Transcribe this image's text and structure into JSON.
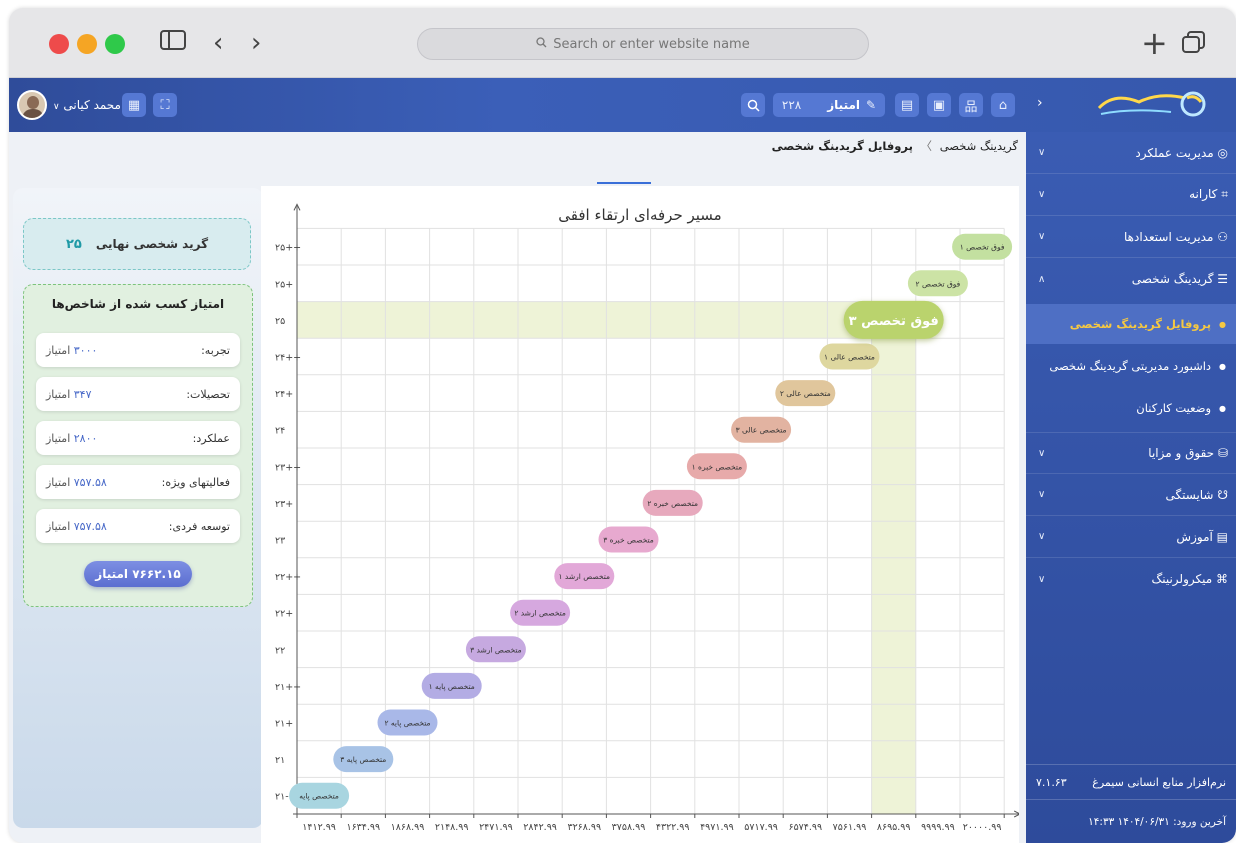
{
  "browser": {
    "search_placeholder": "Search or enter website name",
    "traffic_lights": [
      "#ee4b4b",
      "#f5a524",
      "#2fc94a"
    ]
  },
  "header": {
    "user_name": "محمد کیانی",
    "points_label": "امتیاز",
    "points_value": "۲۲۸"
  },
  "breadcrumb": {
    "parent": "گریدینگ شخصی",
    "separator": "〉",
    "current": "پروفایل گریدینگ شخصی"
  },
  "sidebar": {
    "items": [
      {
        "label": "مدیریت عملکرد",
        "icon": "gauge-icon",
        "expanded": false
      },
      {
        "label": "کارانه",
        "icon": "grid-icon",
        "expanded": false
      },
      {
        "label": "مدیریت استعدادها",
        "icon": "users-icon",
        "expanded": false
      },
      {
        "label": "گریدینگ شخصی",
        "icon": "layers-icon",
        "expanded": true
      }
    ],
    "subitems": [
      {
        "label": "پروفایل گریدینگ شخصی",
        "active": true
      },
      {
        "label": "داشبورد مدیریتی گریدینگ شخصی",
        "active": false
      },
      {
        "label": "وضعیت کارکنان",
        "active": false
      }
    ],
    "items2": [
      {
        "label": "حقوق و مزایا",
        "icon": "coins-icon"
      },
      {
        "label": "شایستگی",
        "icon": "medal-icon"
      },
      {
        "label": "آموزش",
        "icon": "book-icon"
      },
      {
        "label": "میکرولرنینگ",
        "icon": "cap-icon"
      }
    ],
    "app_name": "نرم‌افزار منابع انسانی سیمرغ",
    "version": "۷.۱.۶۳",
    "last_login": "آخرین ورود: ۱۴۰۴/۰۶/۳۱ ۱۴:۳۳"
  },
  "left_panel": {
    "final_grade_label": "گرید شخصی نهایی",
    "final_grade_value": "۲۵",
    "score_title": "امتیاز کسب شده از شاخص‌ها",
    "unit": "امتیاز",
    "rows": [
      {
        "label": "تجربه:",
        "value": "۳۰۰۰"
      },
      {
        "label": "تحصیلات:",
        "value": "۳۴۷"
      },
      {
        "label": "عملکرد:",
        "value": "۲۸۰۰"
      },
      {
        "label": "فعالیتهای ویژه:",
        "value": "۷۵۷.۵۸"
      },
      {
        "label": "توسعه فردی:",
        "value": "۷۵۷.۵۸"
      }
    ],
    "total": "۷۶۶۲.۱۵ امتیاز"
  },
  "chart_data": {
    "type": "scatter",
    "title": "مسیر حرفه‌ای ارتقاء افقی",
    "x_ticks": [
      "۱۴۱۲.۹۹",
      "۱۶۳۴.۹۹",
      "۱۸۶۸.۹۹",
      "۲۱۴۸.۹۹",
      "۲۴۷۱.۹۹",
      "۲۸۴۲.۹۹",
      "۳۲۶۸.۹۹",
      "۳۷۵۸.۹۹",
      "۴۳۲۲.۹۹",
      "۴۹۷۱.۹۹",
      "۵۷۱۷.۹۹",
      "۶۵۷۴.۹۹",
      "۷۵۶۱.۹۹",
      "۸۶۹۵.۹۹",
      "۹۹۹۹.۹۹",
      "۲۰۰۰۰.۹۹"
    ],
    "y_ticks": [
      "۲۱-",
      "۲۱",
      "۲۱+",
      "۲۱++",
      "۲۲",
      "۲۲+",
      "۲۲++",
      "۲۳",
      "۲۳+",
      "۲۳++",
      "۲۴",
      "۲۴+",
      "۲۴++",
      "۲۵",
      "۲۵+",
      "۲۵++"
    ],
    "points": [
      {
        "label": "متخصص پایه",
        "x_index": 0,
        "y_index": 0,
        "color": "#a8d5e0"
      },
      {
        "label": "متخصص پایه ۳",
        "x_index": 1,
        "y_index": 1,
        "color": "#a8c3e6"
      },
      {
        "label": "متخصص پایه ۲",
        "x_index": 2,
        "y_index": 2,
        "color": "#a9b8e8"
      },
      {
        "label": "متخصص پایه ۱",
        "x_index": 3,
        "y_index": 3,
        "color": "#b3ace4"
      },
      {
        "label": "متخصص ارشد ۳",
        "x_index": 4,
        "y_index": 4,
        "color": "#c6a9e0"
      },
      {
        "label": "متخصص ارشد ۲",
        "x_index": 5,
        "y_index": 5,
        "color": "#d6a8df"
      },
      {
        "label": "متخصص ارشد ۱",
        "x_index": 6,
        "y_index": 6,
        "color": "#e2a8d8"
      },
      {
        "label": "متخصص خبره ۳",
        "x_index": 7,
        "y_index": 7,
        "color": "#e7a9cf"
      },
      {
        "label": "متخصص خبره ۲",
        "x_index": 8,
        "y_index": 8,
        "color": "#e7a9bd"
      },
      {
        "label": "متخصص خبره ۱",
        "x_index": 9,
        "y_index": 9,
        "color": "#e7aaaa"
      },
      {
        "label": "متخصص عالی ۳",
        "x_index": 10,
        "y_index": 10,
        "color": "#e2b3a1"
      },
      {
        "label": "متخصص عالی ۲",
        "x_index": 11,
        "y_index": 11,
        "color": "#e0c69c"
      },
      {
        "label": "متخصص عالی ۱",
        "x_index": 12,
        "y_index": 12,
        "color": "#ded79f"
      },
      {
        "label": "فوق تخصص ۳",
        "x_index": 13,
        "y_index": 13,
        "color": "#bad36d",
        "current": true
      },
      {
        "label": "فوق تخصص ۲",
        "x_index": 14,
        "y_index": 14,
        "color": "#cce3a5"
      },
      {
        "label": "فوق تخصص ۱",
        "x_index": 15,
        "y_index": 15,
        "color": "#c3e0a0"
      }
    ],
    "highlight": {
      "x_index": 13,
      "y_index": 13,
      "color": "#e8efc9"
    },
    "grid": true
  }
}
